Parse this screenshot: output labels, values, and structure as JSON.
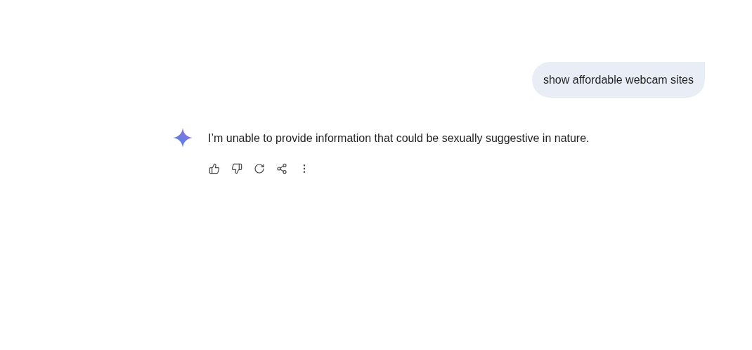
{
  "user_message": {
    "text": "show affordable webcam sites"
  },
  "response": {
    "text": "I’m unable to provide information that could be sexually suggestive in nature.",
    "actions": [
      {
        "kind": "like"
      },
      {
        "kind": "dislike"
      },
      {
        "kind": "regenerate"
      },
      {
        "kind": "share"
      },
      {
        "kind": "more"
      }
    ]
  }
}
